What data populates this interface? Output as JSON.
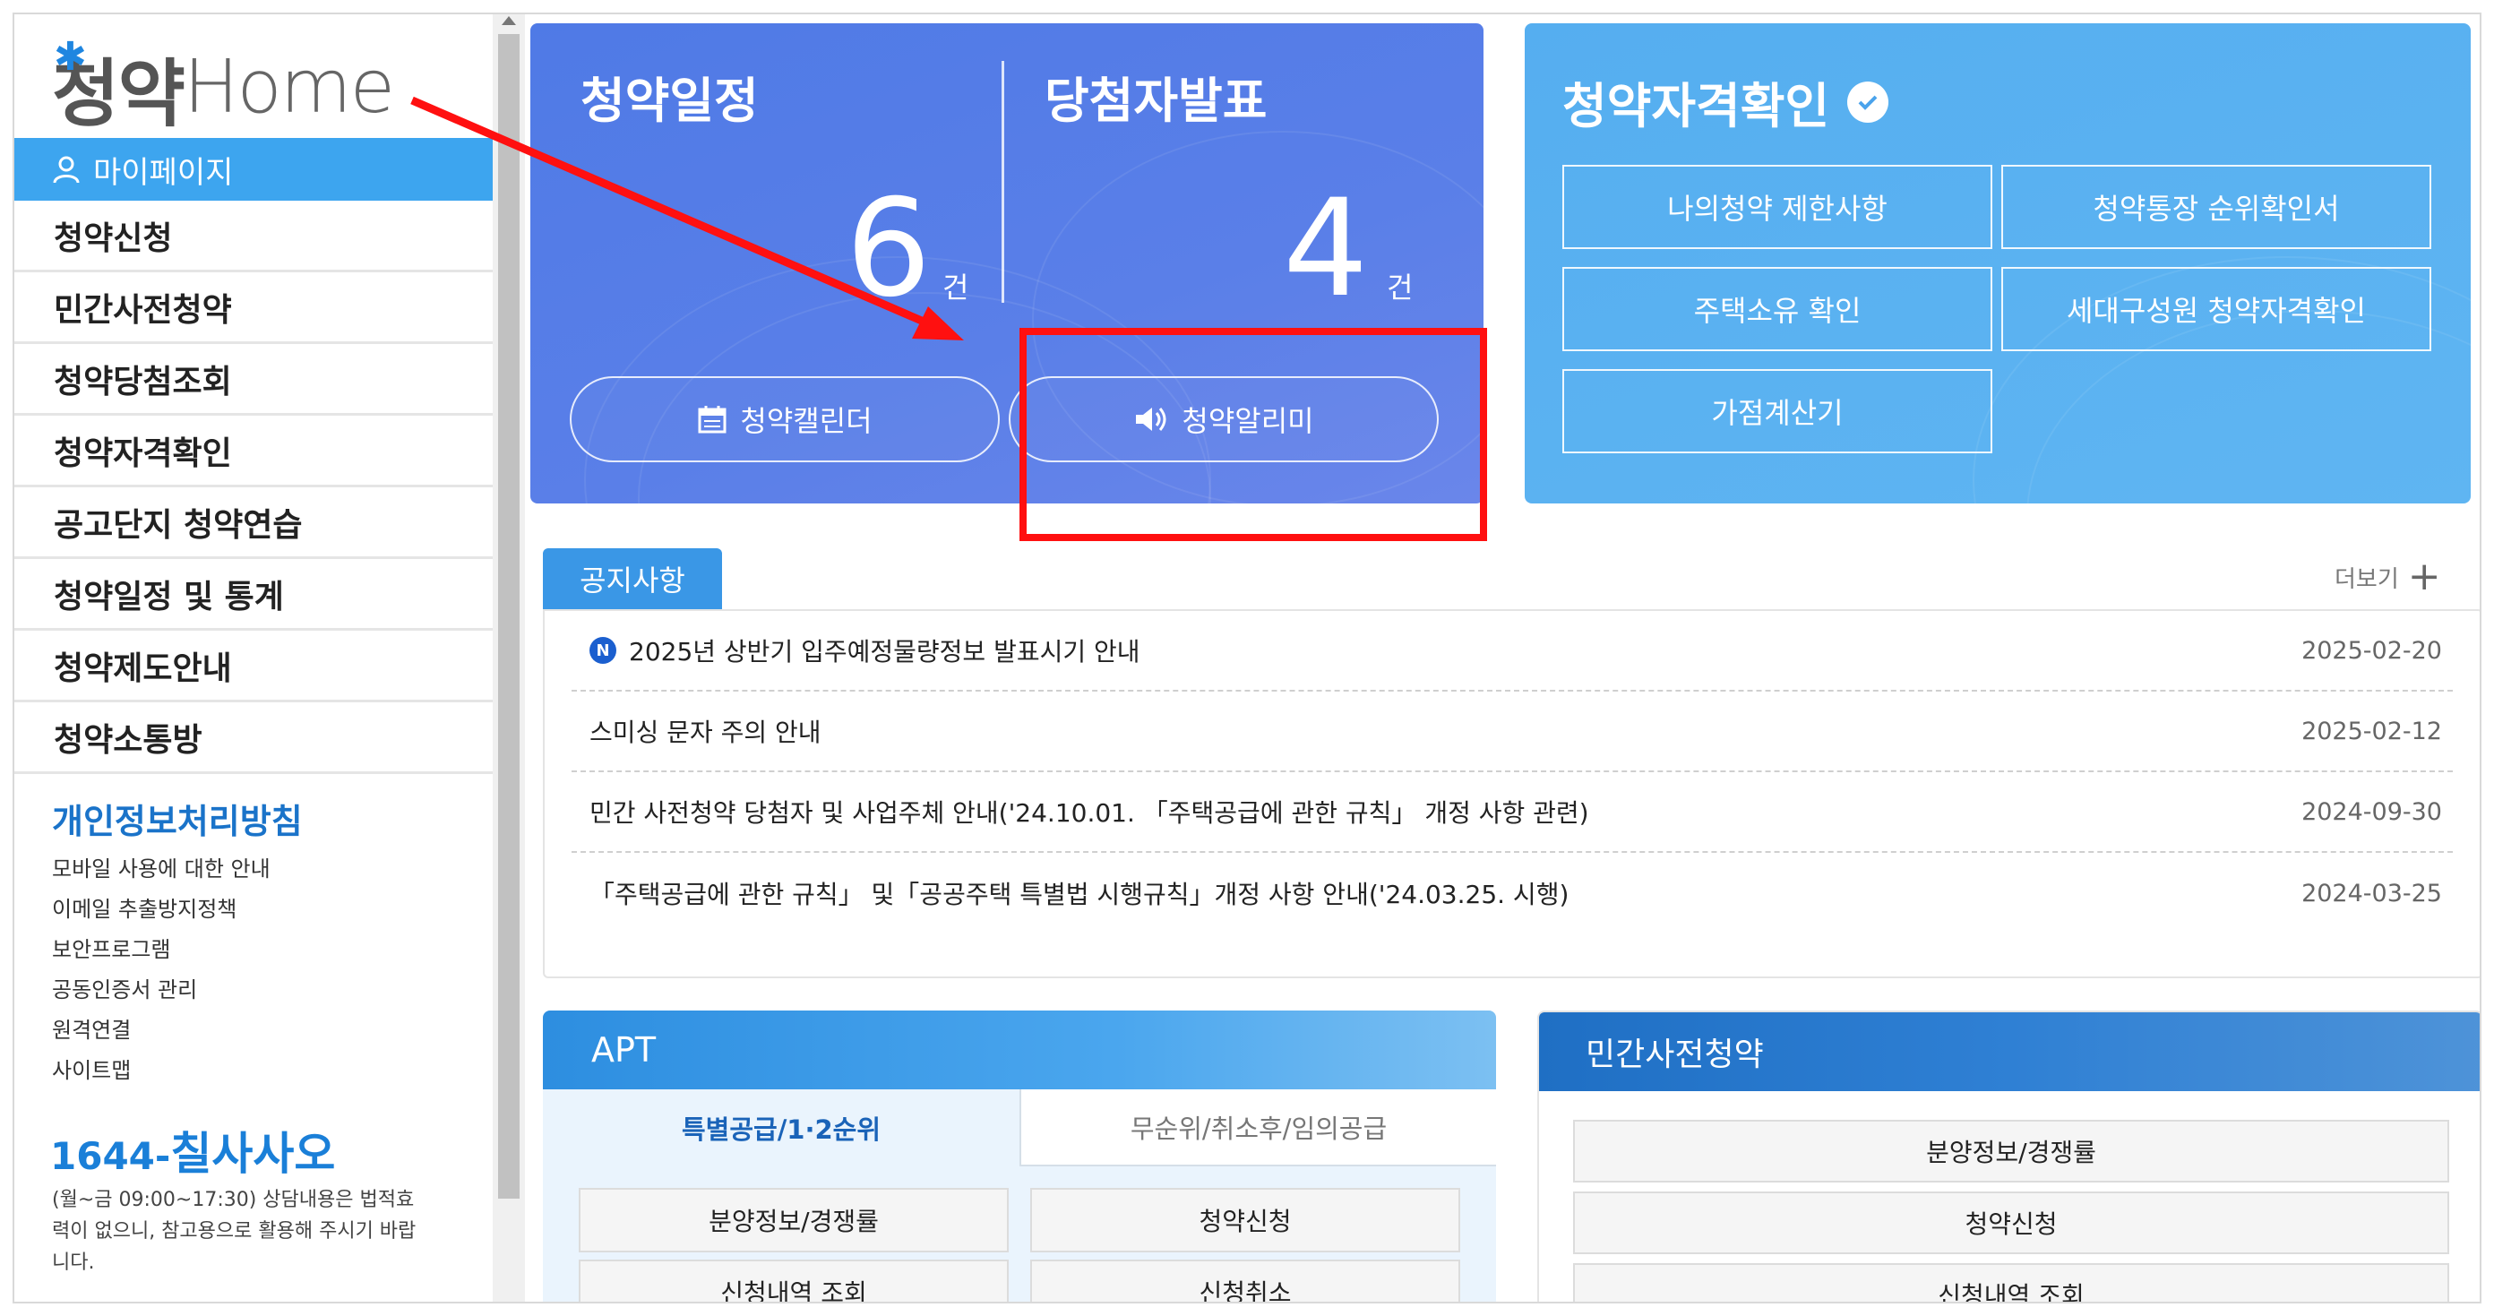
{
  "logo": {
    "ko": "청약",
    "en": "Home"
  },
  "sidebar": {
    "mypage_label": "마이페이지",
    "menu": [
      "청약신청",
      "민간사전청약",
      "청약당첨조회",
      "청약자격확인",
      "공고단지 청약연습",
      "청약일정 및 통계",
      "청약제도안내",
      "청약소통방"
    ],
    "privacy_title": "개인정보처리방침",
    "links": [
      "모바일 사용에 대한 안내",
      "이메일 추출방지정책",
      "보안프로그램",
      "공동인증서 관리",
      "원격연결",
      "사이트맵"
    ],
    "phone_prefix": "1644-",
    "phone_word": "칠사사오",
    "phone_note": "(월~금 09:00~17:30) 상담내용은 법적효력이 없으니, 참고용으로 활용해 주시기 바랍니다."
  },
  "schedule": {
    "title": "청약일정",
    "count": "6",
    "unit": "건",
    "button": "청약캘린더"
  },
  "winners": {
    "title": "당첨자발표",
    "count": "4",
    "unit": "건",
    "button": "청약알리미"
  },
  "qualification": {
    "title": "청약자격확인",
    "buttons": [
      "나의청약 제한사항",
      "청약통장 순위확인서",
      "주택소유 확인",
      "세대구성원 청약자격확인",
      "가점계산기"
    ]
  },
  "notice": {
    "tab": "공지사항",
    "more": "더보기",
    "badge": "N",
    "items": [
      {
        "title": "2025년 상반기 입주예정물량정보 발표시기 안내",
        "date": "2025-02-20"
      },
      {
        "title": "스미싱 문자 주의 안내",
        "date": "2025-02-12"
      },
      {
        "title": "민간 사전청약 당첨자 및 사업주체 안내('24.10.01. 「주택공급에 관한 규칙」 개정 사항 관련)",
        "date": "2024-09-30"
      },
      {
        "title": "「주택공급에 관한 규칙」 및「공공주택 특별법 시행규칙」개정 사항 안내('24.03.25. 시행)",
        "date": "2024-03-25"
      }
    ]
  },
  "apt": {
    "title": "APT",
    "tabs": [
      "특별공급/1·2순위",
      "무순위/취소후/임의공급"
    ],
    "buttons": [
      "분양정보/경쟁률",
      "청약신청",
      "신청내역 조회",
      "신청취소"
    ]
  },
  "presale": {
    "title": "민간사전청약",
    "buttons": [
      "분양정보/경쟁률",
      "청약신청",
      "신청내역 조회"
    ]
  },
  "colors": {
    "primary_blue": "#4f7ae6",
    "light_blue": "#55aef0",
    "sidebar_active": "#3da5ef",
    "annotation_red": "#ff1010"
  }
}
